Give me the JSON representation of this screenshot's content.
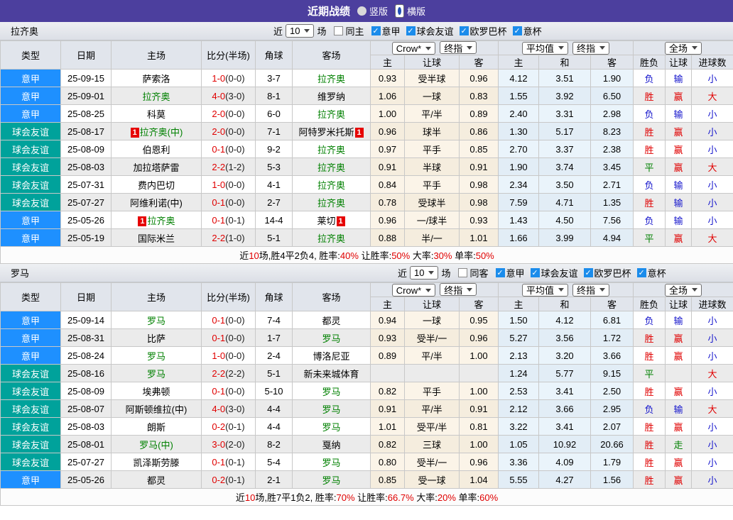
{
  "title_bar": {
    "title": "近期战绩",
    "options": [
      {
        "label": "竖版",
        "selected": false
      },
      {
        "label": "横版",
        "selected": true
      }
    ]
  },
  "icons": {
    "check": "✓",
    "red_card_text": "1"
  },
  "colors": {
    "title_bg": "#4c3f9e",
    "serie_a_badge": "#1e90ff",
    "friendly_badge": "#00a29b",
    "team_highlight_green": "#008000",
    "win_red": "#e00000",
    "lose_blue": "#1414cc",
    "draw_green": "#008000",
    "handicap_cols_bg": "#fbf4e8",
    "average_cols_bg": "#eaf4fb"
  },
  "filter": {
    "near": "近",
    "count": "10",
    "games": "场",
    "leagues": [
      "意甲",
      "球会友谊",
      "欧罗巴杯",
      "意杯"
    ]
  },
  "header": {
    "cols": [
      "类型",
      "日期",
      "主场",
      "比分(半场)",
      "角球",
      "客场"
    ],
    "sub": [
      "主",
      "让球",
      "客",
      "主",
      "和",
      "客",
      "胜负",
      "让球",
      "进球数"
    ],
    "selects": {
      "bookmaker": "Crow*",
      "final1": "终指",
      "average": "平均值",
      "final2": "终指",
      "scope": "全场"
    }
  },
  "sections": [
    {
      "team": "拉齐奥",
      "same_label": "同主",
      "rows": [
        {
          "lt": "s",
          "league": "意甲",
          "date": "25-09-15",
          "home": "萨索洛",
          "hg": false,
          "hcard": false,
          "ft": "1-0",
          "ht": "(0-0)",
          "corner": "3-7",
          "away": "拉齐奥",
          "ag": true,
          "acard": false,
          "odds": [
            "0.93",
            "受半球",
            "0.96"
          ],
          "avg": [
            "4.12",
            "3.51",
            "1.90"
          ],
          "res": [
            [
              "负",
              "b"
            ],
            [
              "输",
              "b"
            ],
            [
              "小",
              "b"
            ]
          ]
        },
        {
          "lt": "s",
          "league": "意甲",
          "date": "25-09-01",
          "home": "拉齐奥",
          "hg": true,
          "hcard": false,
          "ft": "4-0",
          "ht": "(3-0)",
          "corner": "8-1",
          "away": "维罗纳",
          "ag": false,
          "acard": false,
          "odds": [
            "1.06",
            "一球",
            "0.83"
          ],
          "avg": [
            "1.55",
            "3.92",
            "6.50"
          ],
          "res": [
            [
              "胜",
              "r"
            ],
            [
              "赢",
              "r"
            ],
            [
              "大",
              "r"
            ]
          ]
        },
        {
          "lt": "s",
          "league": "意甲",
          "date": "25-08-25",
          "home": "科莫",
          "hg": false,
          "hcard": false,
          "ft": "2-0",
          "ht": "(0-0)",
          "corner": "6-0",
          "away": "拉齐奥",
          "ag": true,
          "acard": false,
          "odds": [
            "1.00",
            "平/半",
            "0.89"
          ],
          "avg": [
            "2.40",
            "3.31",
            "2.98"
          ],
          "res": [
            [
              "负",
              "b"
            ],
            [
              "输",
              "b"
            ],
            [
              "小",
              "b"
            ]
          ]
        },
        {
          "lt": "f",
          "league": "球会友谊",
          "date": "25-08-17",
          "home": "拉齐奥(中)",
          "hg": true,
          "hcard": true,
          "ft": "2-0",
          "ht": "(0-0)",
          "corner": "7-1",
          "away": "阿特罗米托斯",
          "ag": false,
          "acard": true,
          "odds": [
            "0.96",
            "球半",
            "0.86"
          ],
          "avg": [
            "1.30",
            "5.17",
            "8.23"
          ],
          "res": [
            [
              "胜",
              "r"
            ],
            [
              "赢",
              "r"
            ],
            [
              "小",
              "b"
            ]
          ]
        },
        {
          "lt": "f",
          "league": "球会友谊",
          "date": "25-08-09",
          "home": "伯恩利",
          "hg": false,
          "hcard": false,
          "ft": "0-1",
          "ht": "(0-0)",
          "corner": "9-2",
          "away": "拉齐奥",
          "ag": true,
          "acard": false,
          "odds": [
            "0.97",
            "平手",
            "0.85"
          ],
          "avg": [
            "2.70",
            "3.37",
            "2.38"
          ],
          "res": [
            [
              "胜",
              "r"
            ],
            [
              "赢",
              "r"
            ],
            [
              "小",
              "b"
            ]
          ]
        },
        {
          "lt": "f",
          "league": "球会友谊",
          "date": "25-08-03",
          "home": "加拉塔萨雷",
          "hg": false,
          "hcard": false,
          "ft": "2-2",
          "ht": "(1-2)",
          "corner": "5-3",
          "away": "拉齐奥",
          "ag": true,
          "acard": false,
          "odds": [
            "0.91",
            "半球",
            "0.91"
          ],
          "avg": [
            "1.90",
            "3.74",
            "3.45"
          ],
          "res": [
            [
              "平",
              "g"
            ],
            [
              "赢",
              "r"
            ],
            [
              "大",
              "r"
            ]
          ]
        },
        {
          "lt": "f",
          "league": "球会友谊",
          "date": "25-07-31",
          "home": "费内巴切",
          "hg": false,
          "hcard": false,
          "ft": "1-0",
          "ht": "(0-0)",
          "corner": "4-1",
          "away": "拉齐奥",
          "ag": true,
          "acard": false,
          "odds": [
            "0.84",
            "平手",
            "0.98"
          ],
          "avg": [
            "2.34",
            "3.50",
            "2.71"
          ],
          "res": [
            [
              "负",
              "b"
            ],
            [
              "输",
              "b"
            ],
            [
              "小",
              "b"
            ]
          ]
        },
        {
          "lt": "f",
          "league": "球会友谊",
          "date": "25-07-27",
          "home": "阿维利诺(中)",
          "hg": false,
          "hcard": false,
          "ft": "0-1",
          "ht": "(0-0)",
          "corner": "2-7",
          "away": "拉齐奥",
          "ag": true,
          "acard": false,
          "odds": [
            "0.78",
            "受球半",
            "0.98"
          ],
          "avg": [
            "7.59",
            "4.71",
            "1.35"
          ],
          "res": [
            [
              "胜",
              "r"
            ],
            [
              "输",
              "b"
            ],
            [
              "小",
              "b"
            ]
          ]
        },
        {
          "lt": "s",
          "league": "意甲",
          "date": "25-05-26",
          "home": "拉齐奥",
          "hg": true,
          "hcard": true,
          "ft": "0-1",
          "ht": "(0-1)",
          "corner": "14-4",
          "away": "莱切",
          "ag": false,
          "acard": true,
          "odds": [
            "0.96",
            "一/球半",
            "0.93"
          ],
          "avg": [
            "1.43",
            "4.50",
            "7.56"
          ],
          "res": [
            [
              "负",
              "b"
            ],
            [
              "输",
              "b"
            ],
            [
              "小",
              "b"
            ]
          ]
        },
        {
          "lt": "s",
          "league": "意甲",
          "date": "25-05-19",
          "home": "国际米兰",
          "hg": false,
          "hcard": false,
          "ft": "2-2",
          "ht": "(1-0)",
          "corner": "5-1",
          "away": "拉齐奥",
          "ag": true,
          "acard": false,
          "odds": [
            "0.88",
            "半/一",
            "1.01"
          ],
          "avg": [
            "1.66",
            "3.99",
            "4.94"
          ],
          "res": [
            [
              "平",
              "g"
            ],
            [
              "赢",
              "r"
            ],
            [
              "大",
              "r"
            ]
          ]
        }
      ],
      "summary": [
        [
          "近",
          0
        ],
        [
          "10",
          1
        ],
        [
          "场,胜4平2负4, 胜率:",
          0
        ],
        [
          "40%",
          1
        ],
        [
          " 让胜率:",
          0
        ],
        [
          "50%",
          1
        ],
        [
          " 大率:",
          0
        ],
        [
          "30%",
          1
        ],
        [
          " 单率:",
          0
        ],
        [
          "50%",
          1
        ]
      ]
    },
    {
      "team": "罗马",
      "same_label": "同客",
      "rows": [
        {
          "lt": "s",
          "league": "意甲",
          "date": "25-09-14",
          "home": "罗马",
          "hg": true,
          "hcard": false,
          "ft": "0-1",
          "ht": "(0-0)",
          "corner": "7-4",
          "away": "都灵",
          "ag": false,
          "acard": false,
          "odds": [
            "0.94",
            "一球",
            "0.95"
          ],
          "avg": [
            "1.50",
            "4.12",
            "6.81"
          ],
          "res": [
            [
              "负",
              "b"
            ],
            [
              "输",
              "b"
            ],
            [
              "小",
              "b"
            ]
          ]
        },
        {
          "lt": "s",
          "league": "意甲",
          "date": "25-08-31",
          "home": "比萨",
          "hg": false,
          "hcard": false,
          "ft": "0-1",
          "ht": "(0-0)",
          "corner": "1-7",
          "away": "罗马",
          "ag": true,
          "acard": false,
          "odds": [
            "0.93",
            "受半/一",
            "0.96"
          ],
          "avg": [
            "5.27",
            "3.56",
            "1.72"
          ],
          "res": [
            [
              "胜",
              "r"
            ],
            [
              "赢",
              "r"
            ],
            [
              "小",
              "b"
            ]
          ]
        },
        {
          "lt": "s",
          "league": "意甲",
          "date": "25-08-24",
          "home": "罗马",
          "hg": true,
          "hcard": false,
          "ft": "1-0",
          "ht": "(0-0)",
          "corner": "2-4",
          "away": "博洛尼亚",
          "ag": false,
          "acard": false,
          "odds": [
            "0.89",
            "平/半",
            "1.00"
          ],
          "avg": [
            "2.13",
            "3.20",
            "3.66"
          ],
          "res": [
            [
              "胜",
              "r"
            ],
            [
              "赢",
              "r"
            ],
            [
              "小",
              "b"
            ]
          ]
        },
        {
          "lt": "f",
          "league": "球会友谊",
          "date": "25-08-16",
          "home": "罗马",
          "hg": true,
          "hcard": false,
          "ft": "2-2",
          "ht": "(2-2)",
          "corner": "5-1",
          "away": "新未来城体育",
          "ag": false,
          "acard": false,
          "odds": [
            "",
            "",
            ""
          ],
          "avg": [
            "1.24",
            "5.77",
            "9.15"
          ],
          "res": [
            [
              "平",
              "g"
            ],
            [
              "",
              ""
            ],
            [
              "大",
              "r"
            ]
          ]
        },
        {
          "lt": "f",
          "league": "球会友谊",
          "date": "25-08-09",
          "home": "埃弗顿",
          "hg": false,
          "hcard": false,
          "ft": "0-1",
          "ht": "(0-0)",
          "corner": "5-10",
          "away": "罗马",
          "ag": true,
          "acard": false,
          "odds": [
            "0.82",
            "平手",
            "1.00"
          ],
          "avg": [
            "2.53",
            "3.41",
            "2.50"
          ],
          "res": [
            [
              "胜",
              "r"
            ],
            [
              "赢",
              "r"
            ],
            [
              "小",
              "b"
            ]
          ]
        },
        {
          "lt": "f",
          "league": "球会友谊",
          "date": "25-08-07",
          "home": "阿斯顿维拉(中)",
          "hg": false,
          "hcard": false,
          "ft": "4-0",
          "ht": "(3-0)",
          "corner": "4-4",
          "away": "罗马",
          "ag": true,
          "acard": false,
          "odds": [
            "0.91",
            "平/半",
            "0.91"
          ],
          "avg": [
            "2.12",
            "3.66",
            "2.95"
          ],
          "res": [
            [
              "负",
              "b"
            ],
            [
              "输",
              "b"
            ],
            [
              "大",
              "r"
            ]
          ]
        },
        {
          "lt": "f",
          "league": "球会友谊",
          "date": "25-08-03",
          "home": "朗斯",
          "hg": false,
          "hcard": false,
          "ft": "0-2",
          "ht": "(0-1)",
          "corner": "4-4",
          "away": "罗马",
          "ag": true,
          "acard": false,
          "odds": [
            "1.01",
            "受平/半",
            "0.81"
          ],
          "avg": [
            "3.22",
            "3.41",
            "2.07"
          ],
          "res": [
            [
              "胜",
              "r"
            ],
            [
              "赢",
              "r"
            ],
            [
              "小",
              "b"
            ]
          ]
        },
        {
          "lt": "f",
          "league": "球会友谊",
          "date": "25-08-01",
          "home": "罗马(中)",
          "hg": true,
          "hcard": false,
          "ft": "3-0",
          "ht": "(2-0)",
          "corner": "8-2",
          "away": "戛纳",
          "ag": false,
          "acard": false,
          "odds": [
            "0.82",
            "三球",
            "1.00"
          ],
          "avg": [
            "1.05",
            "10.92",
            "20.66"
          ],
          "res": [
            [
              "胜",
              "r"
            ],
            [
              "走",
              "g"
            ],
            [
              "小",
              "b"
            ]
          ]
        },
        {
          "lt": "f",
          "league": "球会友谊",
          "date": "25-07-27",
          "home": "凯泽斯劳滕",
          "hg": false,
          "hcard": false,
          "ft": "0-1",
          "ht": "(0-1)",
          "corner": "5-4",
          "away": "罗马",
          "ag": true,
          "acard": false,
          "odds": [
            "0.80",
            "受半/一",
            "0.96"
          ],
          "avg": [
            "3.36",
            "4.09",
            "1.79"
          ],
          "res": [
            [
              "胜",
              "r"
            ],
            [
              "赢",
              "r"
            ],
            [
              "小",
              "b"
            ]
          ]
        },
        {
          "lt": "s",
          "league": "意甲",
          "date": "25-05-26",
          "home": "都灵",
          "hg": false,
          "hcard": false,
          "ft": "0-2",
          "ht": "(0-1)",
          "corner": "2-1",
          "away": "罗马",
          "ag": true,
          "acard": false,
          "odds": [
            "0.85",
            "受一球",
            "1.04"
          ],
          "avg": [
            "5.55",
            "4.27",
            "1.56"
          ],
          "res": [
            [
              "胜",
              "r"
            ],
            [
              "赢",
              "r"
            ],
            [
              "小",
              "b"
            ]
          ]
        }
      ],
      "summary": [
        [
          "近",
          0
        ],
        [
          "10",
          1
        ],
        [
          "场,胜7平1负2, 胜率:",
          0
        ],
        [
          "70%",
          1
        ],
        [
          " 让胜率:",
          0
        ],
        [
          "66.7%",
          1
        ],
        [
          " 大率:",
          0
        ],
        [
          "20%",
          1
        ],
        [
          " 单率:",
          0
        ],
        [
          "60%",
          1
        ]
      ]
    }
  ]
}
